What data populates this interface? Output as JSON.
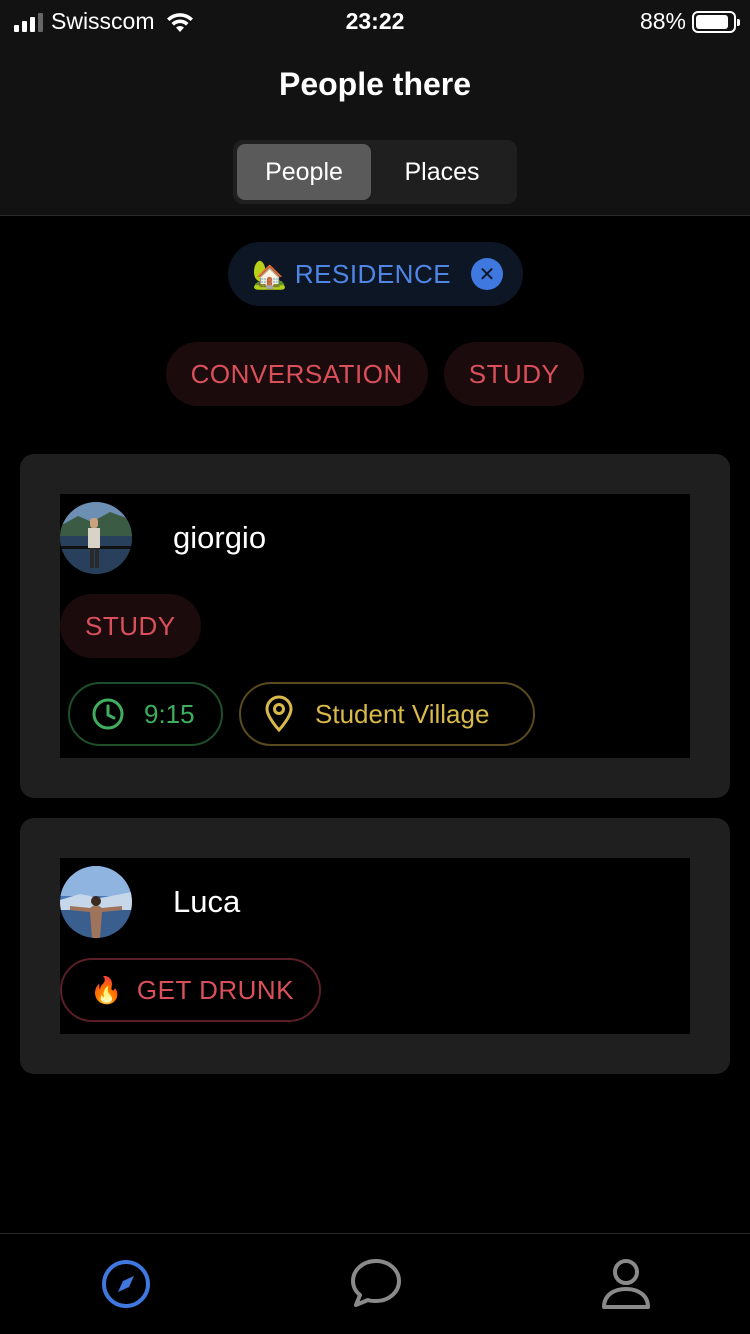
{
  "status_bar": {
    "carrier": "Swisscom",
    "time": "23:22",
    "battery_percent": "88%",
    "battery_level": 0.88
  },
  "header": {
    "title": "People there"
  },
  "segments": [
    {
      "label": "People",
      "active": true
    },
    {
      "label": "Places",
      "active": false
    }
  ],
  "filter": {
    "emoji": "🏡",
    "label": "RESIDENCE"
  },
  "tags": [
    "CONVERSATION",
    "STUDY"
  ],
  "people": [
    {
      "name": "giorgio",
      "activity": "STUDY",
      "time": "9:15",
      "location": "Student Village"
    },
    {
      "name": "Luca",
      "activity_emoji": "🔥",
      "activity": "GET DRUNK"
    }
  ],
  "colors": {
    "accent_blue": "#4f86e6",
    "activity_red": "#d9505a",
    "time_green": "#3fae5e",
    "location_gold": "#d9b94a"
  },
  "tabbar": {
    "items": [
      "compass-icon",
      "chat-icon",
      "profile-icon"
    ],
    "active": "compass-icon"
  }
}
